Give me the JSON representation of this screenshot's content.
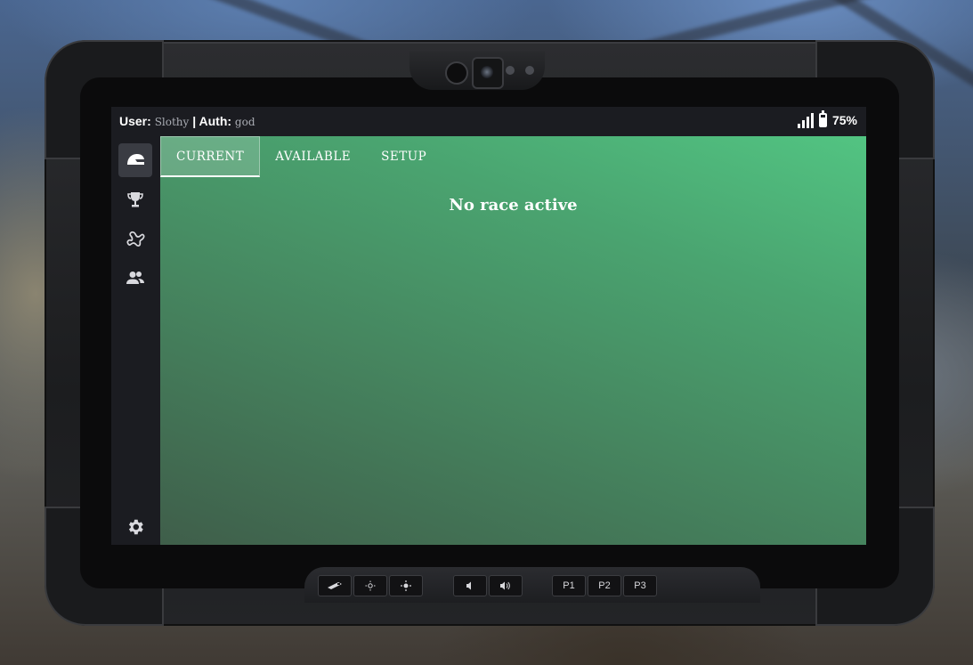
{
  "status": {
    "user_label": "User:",
    "user_value": "Slothy",
    "auth_label": "| Auth:",
    "auth_value": "god",
    "battery_percent": 75,
    "battery_text": "75%",
    "signal_bars": 4,
    "icons": {
      "signal": "signal-icon",
      "battery": "battery-icon"
    }
  },
  "sidebar": {
    "items": [
      {
        "id": "races",
        "icon": "helmet-icon",
        "active": true
      },
      {
        "id": "leaderboard",
        "icon": "trophy-icon",
        "active": false
      },
      {
        "id": "tracks",
        "icon": "track-icon",
        "active": false
      },
      {
        "id": "players",
        "icon": "users-icon",
        "active": false
      }
    ],
    "settings_icon": "gear-icon"
  },
  "tabs": [
    {
      "label": "CURRENT",
      "active": true
    },
    {
      "label": "AVAILABLE",
      "active": false
    },
    {
      "label": "SETUP",
      "active": false
    }
  ],
  "main": {
    "empty_message": "No race active"
  },
  "hardware": {
    "group1": [
      {
        "icon": "usb-icon",
        "label": ""
      },
      {
        "icon": "brightness-low-icon",
        "label": ""
      },
      {
        "icon": "brightness-high-icon",
        "label": ""
      }
    ],
    "group2": [
      {
        "icon": "volume-down-icon",
        "label": ""
      },
      {
        "icon": "volume-up-icon",
        "label": ""
      }
    ],
    "group3": [
      {
        "label": "P1"
      },
      {
        "label": "P2"
      },
      {
        "label": "P3"
      }
    ]
  },
  "colors": {
    "accent_green": "#52c482",
    "statusbar_bg": "#1b1c21",
    "sidebar_active": "#3a3c43"
  }
}
